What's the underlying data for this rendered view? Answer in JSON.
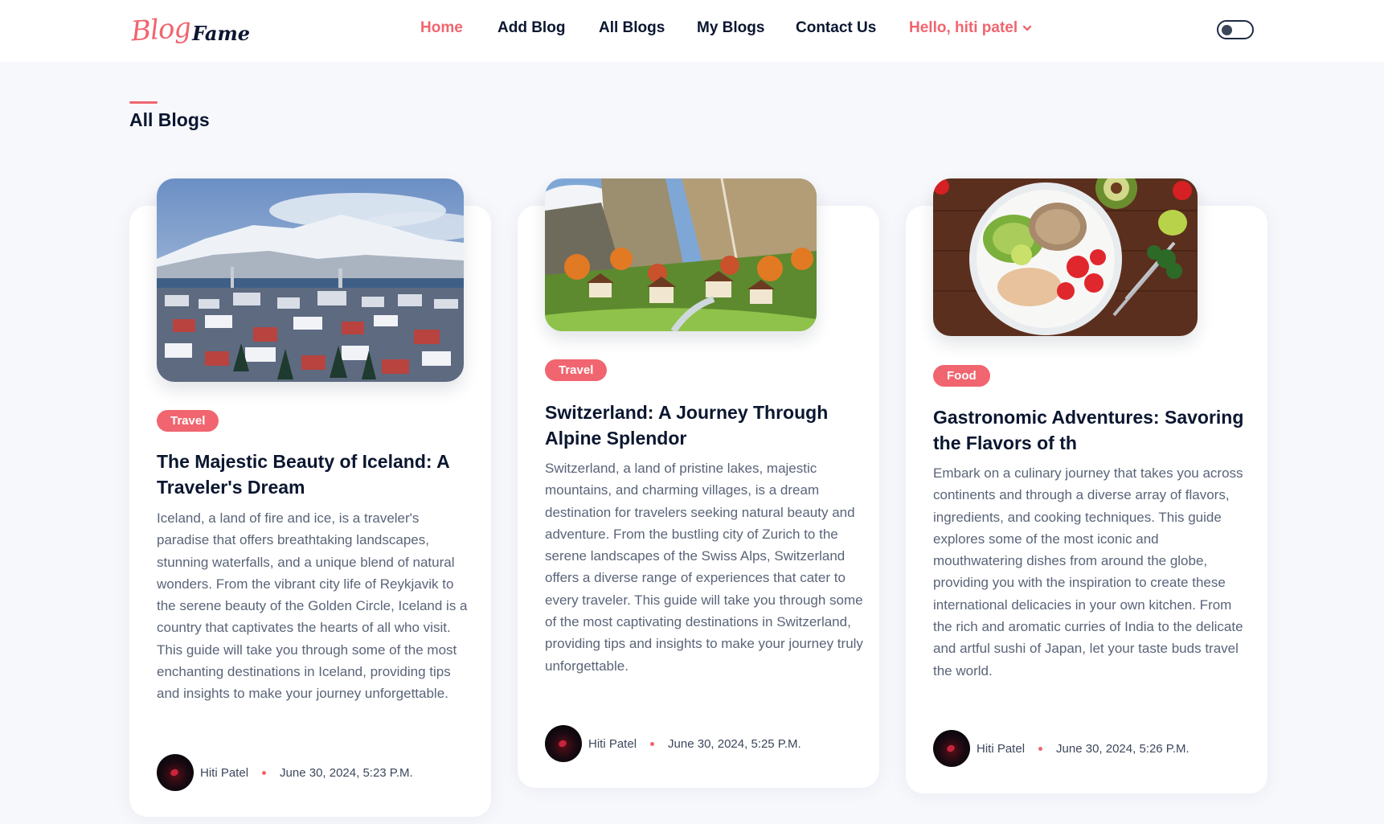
{
  "brand": {
    "logo_part1": "Blog",
    "logo_part2": "Fame"
  },
  "nav": {
    "home": "Home",
    "add_blog": "Add Blog",
    "all_blogs": "All Blogs",
    "my_blogs": "My Blogs",
    "contact": "Contact Us",
    "user": "Hello, hiti patel"
  },
  "colors": {
    "accent": "#f0656f",
    "dark": "#0b1630",
    "background": "#f7f8fc"
  },
  "section": {
    "title": "All Blogs"
  },
  "blogs": [
    {
      "category": "Travel",
      "title": "The Majestic Beauty of Iceland: A Traveler's Dream",
      "excerpt": "Iceland, a land of fire and ice, is a traveler's paradise that offers breathtaking landscapes, stunning waterfalls, and a unique blend of natural wonders. From the vibrant city life of Reykjavik to the serene beauty of the Golden Circle, Iceland is a country that captivates the hearts of all who visit. This guide will take you through some of the most enchanting destinations in Iceland, providing tips and insights to make your journey unforgettable.",
      "author": "Hiti Patel",
      "date": "June 30, 2024, 5:23 P.M.",
      "image": "iceland-town-mountains"
    },
    {
      "category": "Travel",
      "title": "Switzerland: A Journey Through Alpine Splendor",
      "excerpt": "Switzerland, a land of pristine lakes, majestic mountains, and charming villages, is a dream destination for travelers seeking natural beauty and adventure. From the bustling city of Zurich to the serene landscapes of the Swiss Alps, Switzerland offers a diverse range of experiences that cater to every traveler. This guide will take you through some of the most captivating destinations in Switzerland, providing tips and insights to make your journey truly unforgettable.",
      "author": "Hiti Patel",
      "date": "June 30, 2024, 5:25 P.M.",
      "image": "swiss-valley-village"
    },
    {
      "category": "Food",
      "title": "Gastronomic Adventures: Savoring the Flavors of th",
      "excerpt": "Embark on a culinary journey that takes you across continents and through a diverse array of flavors, ingredients, and cooking techniques. This guide explores some of the most iconic and mouthwatering dishes from around the globe, providing you with the inspiration to create these international delicacies in your own kitchen. From the rich and aromatic curries of India to the delicate and artful sushi of Japan, let your taste buds travel the world.",
      "author": "Hiti Patel",
      "date": "June 30, 2024, 5:26 P.M.",
      "image": "healthy-food-bowl"
    }
  ]
}
